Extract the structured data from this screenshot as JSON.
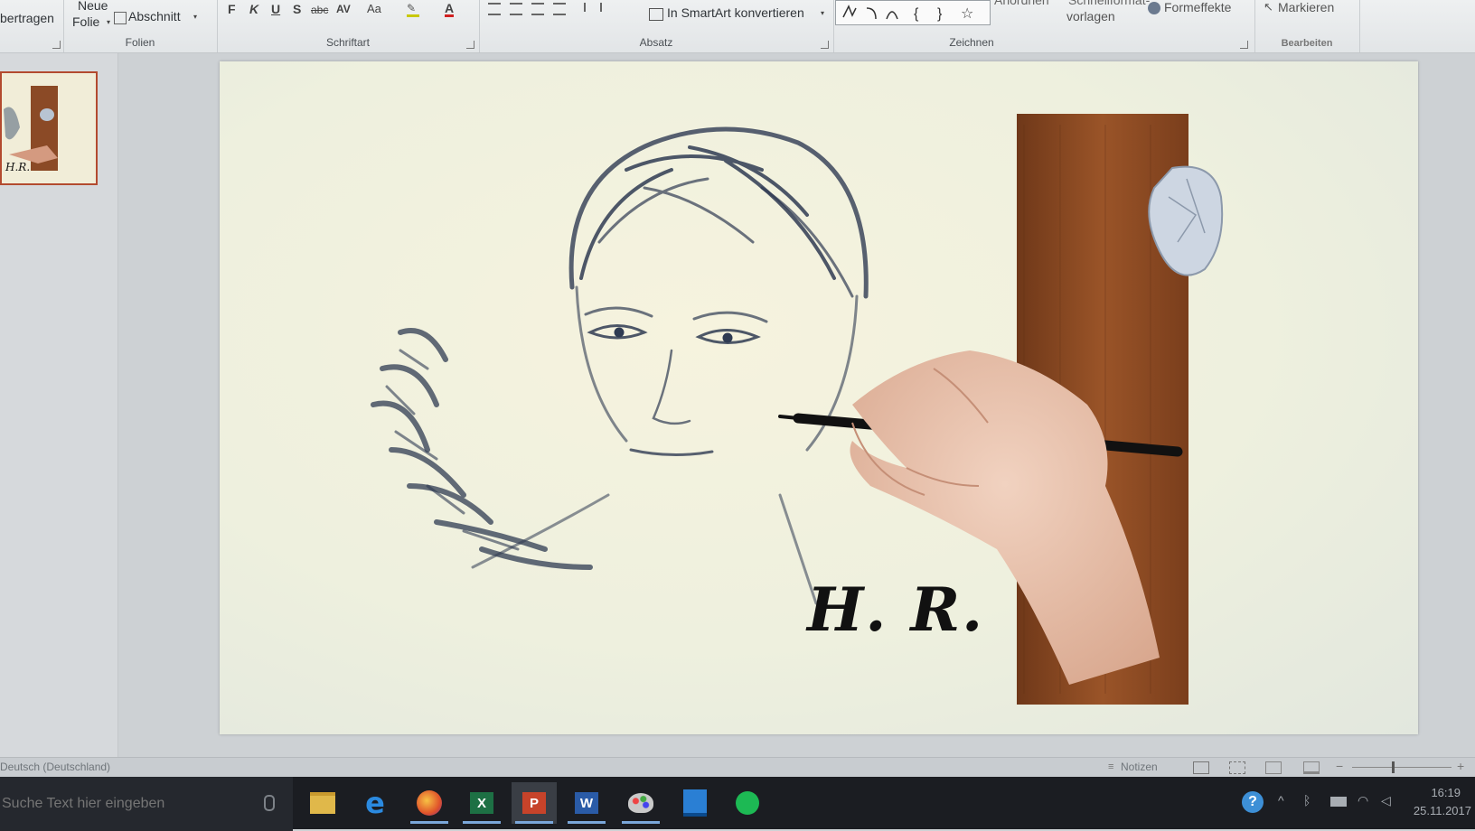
{
  "ribbon": {
    "clipboard": {
      "paste_label": "bertragen"
    },
    "slides": {
      "new_slide_line1": "Neue",
      "new_slide_line2": "Folie",
      "section_label": "Abschnitt",
      "group_label": "Folien"
    },
    "font": {
      "bold": "F",
      "italic": "K",
      "underline": "U",
      "shadow": "S",
      "strike": "abc",
      "spacing": "AV",
      "case": "Aa",
      "color": "A",
      "group_label": "Schriftart"
    },
    "paragraph": {
      "smartart_label": "In SmartArt konvertieren",
      "group_label": "Absatz"
    },
    "drawing": {
      "arrange_label": "Anordnen",
      "quickstyles_label": "Schnellformat-",
      "quickstyles_label2": "vorlagen",
      "effects_label": "Formeffekte",
      "group_label": "Zeichnen"
    },
    "editing": {
      "select_label": "Markieren",
      "group_label": "Bearbeiten"
    }
  },
  "slide": {
    "signature_text": "H. R."
  },
  "statusbar": {
    "language": "Deutsch (Deutschland)",
    "notes_label": "Notizen"
  },
  "taskbar": {
    "search_placeholder": "Suche Text hier eingeben",
    "apps": [
      "file-explorer",
      "edge",
      "firefox",
      "excel",
      "powerpoint",
      "word",
      "paint",
      "image-app",
      "spotify"
    ],
    "time": "16:19",
    "date": "25.11.2017"
  },
  "colors": {
    "taskbar": "#1b1d22",
    "slide_bg": "#f3f1dc",
    "sketch_ink": "#2f3b52",
    "wood": "#8a4a22",
    "thumb_border": "#b34a2f"
  }
}
